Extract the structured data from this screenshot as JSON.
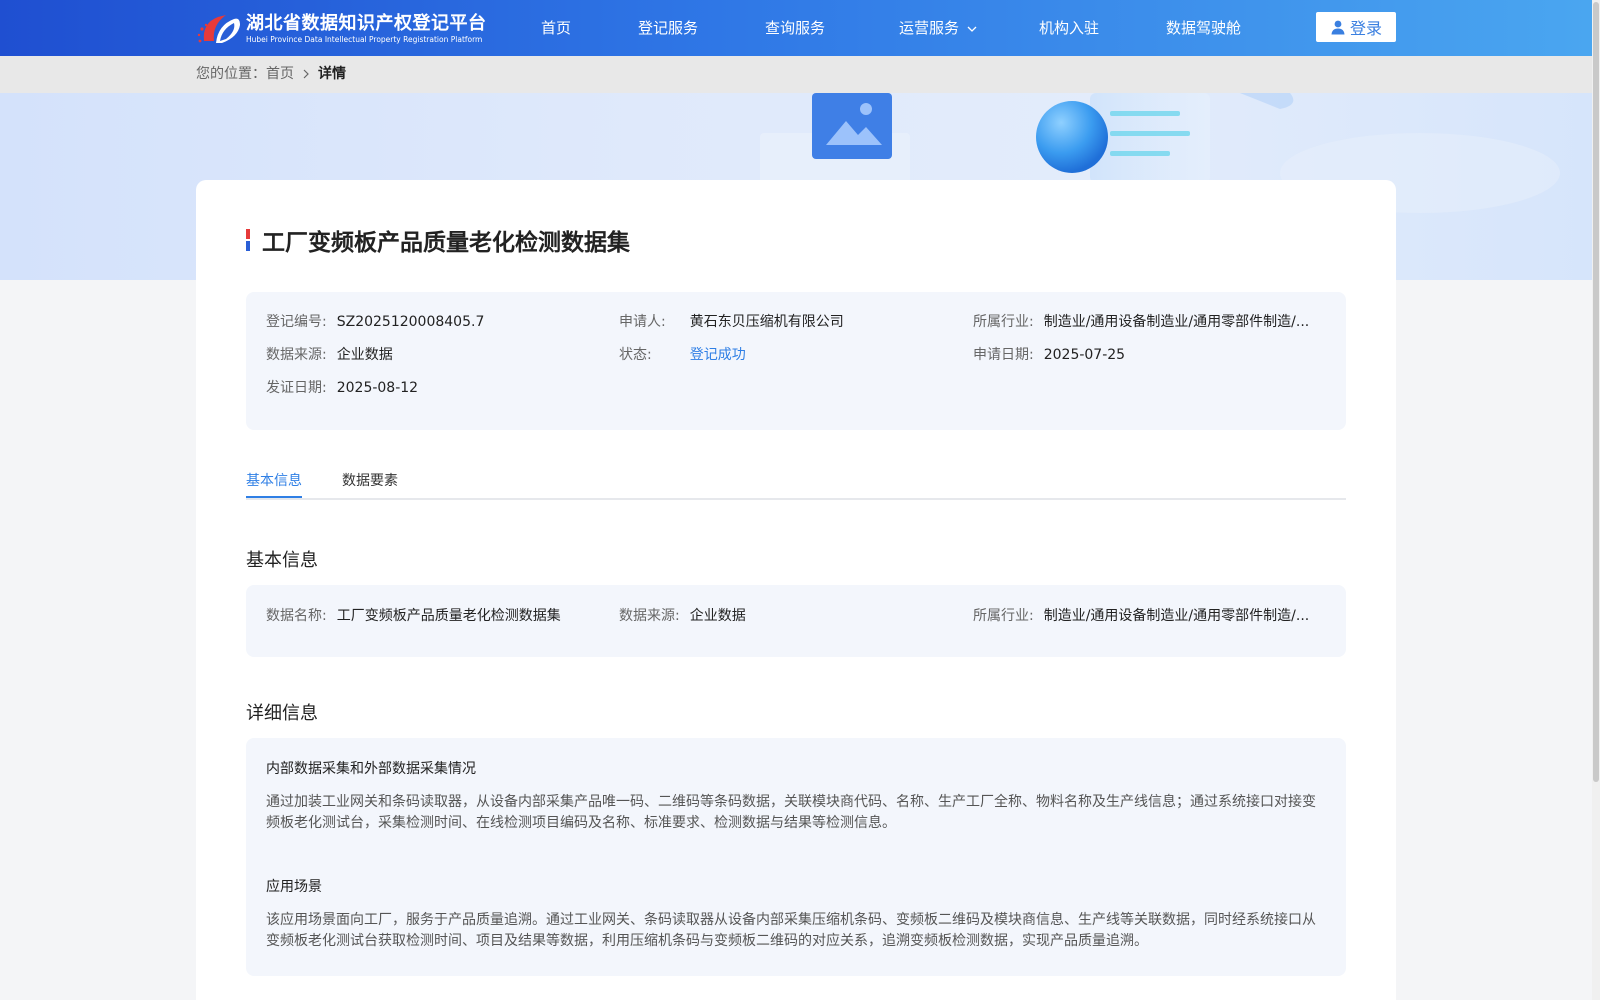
{
  "header": {
    "logo_cn": "湖北省数据知识产权登记平台",
    "logo_en": "Hubei Province Data Intellectual Property Registration Platform",
    "nav": [
      "首页",
      "登记服务",
      "查询服务",
      "运营服务",
      "机构入驻",
      "数据驾驶舱"
    ],
    "login_label": "登录",
    "colors": {
      "primary": "#2f77e6",
      "accent": "#2f7fe5"
    }
  },
  "breadcrumb": {
    "prefix": "您的位置：",
    "home": "首页",
    "current": "详情"
  },
  "detail": {
    "title": "工厂变频板产品质量老化检测数据集",
    "meta": {
      "reg_no_label": "登记编号:",
      "reg_no": "SZ2025120008405.7",
      "applicant_label": "申请人:",
      "applicant": "黄石东贝压缩机有限公司",
      "industry_label": "所属行业:",
      "industry": "制造业/通用设备制造业/通用零部件制造/...",
      "source_label": "数据来源:",
      "source": "企业数据",
      "status_label": "状态:",
      "status": "登记成功",
      "apply_date_label": "申请日期:",
      "apply_date": "2025-07-25",
      "issue_date_label": "发证日期:",
      "issue_date": "2025-08-12"
    },
    "tabs": [
      "基本信息",
      "数据要素"
    ],
    "basic": {
      "section_title": "基本信息",
      "name_label": "数据名称:",
      "name": "工厂变频板产品质量老化检测数据集",
      "source_label": "数据来源:",
      "source": "企业数据",
      "industry_label": "所属行业:",
      "industry": "制造业/通用设备制造业/通用零部件制造/..."
    },
    "info": {
      "section_title": "详细信息",
      "collection_title": "内部数据采集和外部数据采集情况",
      "collection_text": "通过加装工业网关和条码读取器，从设备内部采集产品唯一码、二维码等条码数据，关联模块商代码、名称、生产工厂全称、物料名称及生产线信息；通过系统接口对接变频板老化测试台，采集检测时间、在线检测项目编码及名称、标准要求、检测数据与结果等检测信息。",
      "scenario_title": "应用场景",
      "scenario_text": "该应用场景面向工厂，服务于产品质量追溯。通过工业网关、条码读取器从设备内部采集压缩机条码、变频板二维码及模块商信息、生产线等关联数据，同时经系统接口从变频板老化测试台获取检测时间、项目及结果等数据，利用压缩机条码与变频板二维码的对应关系，追溯变频板检测数据，实现产品质量追溯。"
    }
  }
}
